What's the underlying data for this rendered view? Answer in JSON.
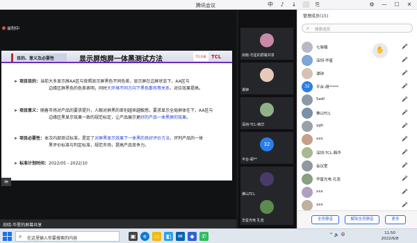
{
  "window": {
    "title": "腾讯会议",
    "controls": [
      "中",
      "♪",
      "↓",
      "⬜",
      "⎘",
      "⚙",
      "—",
      "☐",
      "✕"
    ]
  },
  "share": {
    "recording_label": "录制中",
    "footer_text": "尚晓-华星的屏幕共享"
  },
  "slide": {
    "band_subtitle": "目的、意义及必要性",
    "title": "显示屏炮屏一体黑测试方法",
    "logo_left": "TCL华星",
    "logo_right": "TCL",
    "bullets": [
      {
        "heading": "项目目的：",
        "text": "当前大多显示屏AA区与背照显示屏黑色不同色差，显示屏在边屏状态下，AA区与",
        "text2": "边缘区屏黑色的色差表明，同时",
        "hl": "大环境不同方向下黑色散布等关系",
        "text3": "，对应效果提高。"
      },
      {
        "heading": "项目意义：",
        "text": "随着市场对产品的要求提升，人眼对屏黑的差别越来越敏感，要求显示全局屏体在下，AA区与",
        "text2": "边缘区黑显示效果一致的规范标定，让产品展示更",
        "hl": "好的产品一体黑屏的效果",
        "text3": "。"
      },
      {
        "heading": "项目必要性：",
        "text": "本次内部测试标准，是定了",
        "hl": "对屏黑显示效果下一体黑的良好评价方法",
        "text2": "，评判产品的一体",
        "text3": "黑评价标准与判定标准，规范市场，提高产品竞争力。"
      },
      {
        "heading": "标准计划时间：",
        "text": "2022/05 - 2022/10"
      }
    ]
  },
  "videos": [
    {
      "label": "尚晓-华星的屏幕共享",
      "avatar_color": "#c98aa8"
    },
    {
      "label": "谭钟",
      "avatar_color": "#e8c8b8"
    },
    {
      "label": "深圳-TCL-韩华",
      "avatar_color": "#8fb28a"
    },
    {
      "label": "平台-胡**",
      "avatar_color": "#2b7de9",
      "avatar_text": "32"
    },
    {
      "label": "佛山TCL",
      "avatar_color": "#4a3a6b"
    },
    {
      "label": "华星光电 孔浩",
      "avatar_color": "#5d8a4e"
    }
  ],
  "panel": {
    "title": "管理成员(15)",
    "search_placeholder": "搜索成员",
    "participants": [
      {
        "name": "七晓楠",
        "color": "#b7b9c4"
      },
      {
        "name": "深圳-华星",
        "color": "#7aa6d9"
      },
      {
        "name": "谭钟",
        "color": "#d6c2b0"
      },
      {
        "name": "平台-胡*****",
        "color": "#2b7de9",
        "avatar_text": "32"
      },
      {
        "name": "Sadl",
        "color": "#8a9aa8"
      },
      {
        "name": "佛山TCL",
        "color": "#7a8fa8"
      },
      {
        "name": "ygh",
        "color": "#9aa0a8"
      },
      {
        "name": "xxx",
        "color": "#c4a08a"
      },
      {
        "name": "深圳-TCL-韩华",
        "color": "#a8b890"
      },
      {
        "name": "会议室",
        "color": "#9098a0"
      },
      {
        "name": "华星光电 孔浩",
        "color": "#8aa080"
      },
      {
        "name": "xxx",
        "color": "#b0a0c0"
      },
      {
        "name": "xxx",
        "color": "#c0b0a0"
      }
    ],
    "buttons": [
      "全员静音",
      "解除全员静音",
      "更多"
    ]
  },
  "taskbar": {
    "search_placeholder": "在这里输入你要搜索的内容",
    "tray_text": "^ 🔈 中",
    "time": "11:50",
    "date": "2022/6/8"
  }
}
